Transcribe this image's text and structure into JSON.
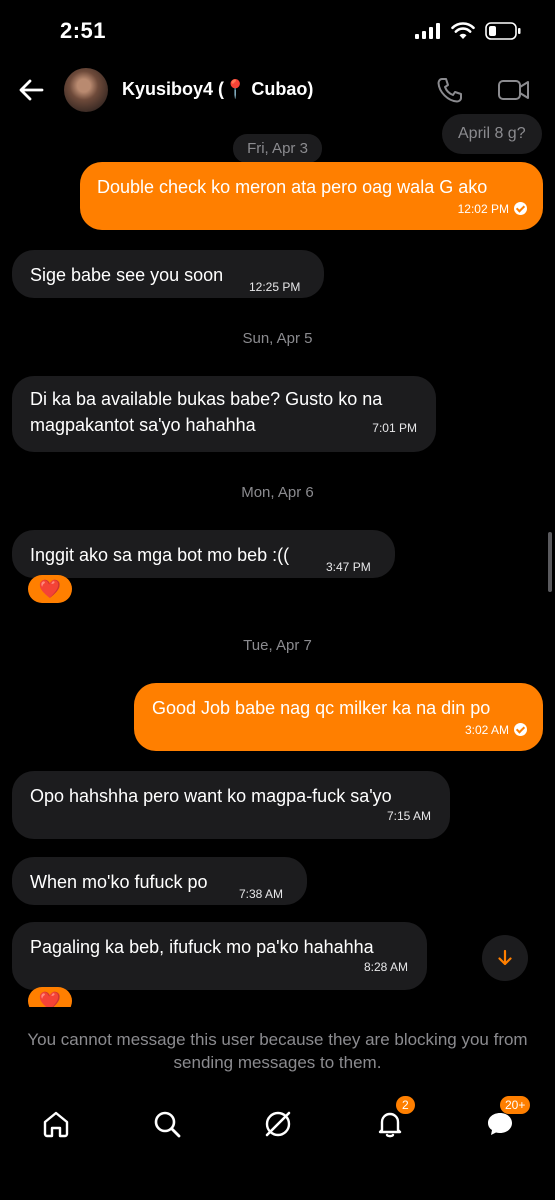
{
  "status_bar": {
    "time": "2:51"
  },
  "header": {
    "contact_name": "Kyusiboy4 (📍 Cubao)"
  },
  "top_partial_message": "April 8 g?",
  "dates": {
    "d1": "Fri, Apr 3",
    "d2": "Sun, Apr 5",
    "d3": "Mon, Apr 6",
    "d4": "Tue, Apr 7"
  },
  "messages": [
    {
      "dir": "out",
      "text": "Double check ko meron ata pero oag wala G ako",
      "time": "12:02 PM"
    },
    {
      "dir": "in",
      "text": "Sige babe see you soon",
      "time": "12:25 PM"
    },
    {
      "dir": "in",
      "text": "Di ka ba available bukas babe? Gusto ko na magpakantot sa'yo hahahha",
      "time": "7:01 PM"
    },
    {
      "dir": "in",
      "text": "Inggit ako sa mga bot mo beb :((",
      "time": "3:47 PM"
    },
    {
      "dir": "out",
      "text": "Good Job babe nag qc milker ka na din po",
      "time": "3:02 AM"
    },
    {
      "dir": "in",
      "text": "Opo hahshha pero want ko magpa-fuck sa'yo",
      "time": "7:15 AM"
    },
    {
      "dir": "in",
      "text": "When mo'ko fufuck po",
      "time": "7:38 AM"
    },
    {
      "dir": "in",
      "text": "Pagaling ka beb, ifufuck mo pa'ko hahahha",
      "time": "8:28 AM"
    }
  ],
  "reaction": "❤️",
  "blocked_notice": "You cannot message this user because they are blocking you from sending messages to them.",
  "nav": {
    "notifications_badge": "2",
    "messages_badge": "20+"
  },
  "colors": {
    "accent": "#ff7f00",
    "incoming_bubble": "#1c1c1e",
    "background": "#000000"
  }
}
